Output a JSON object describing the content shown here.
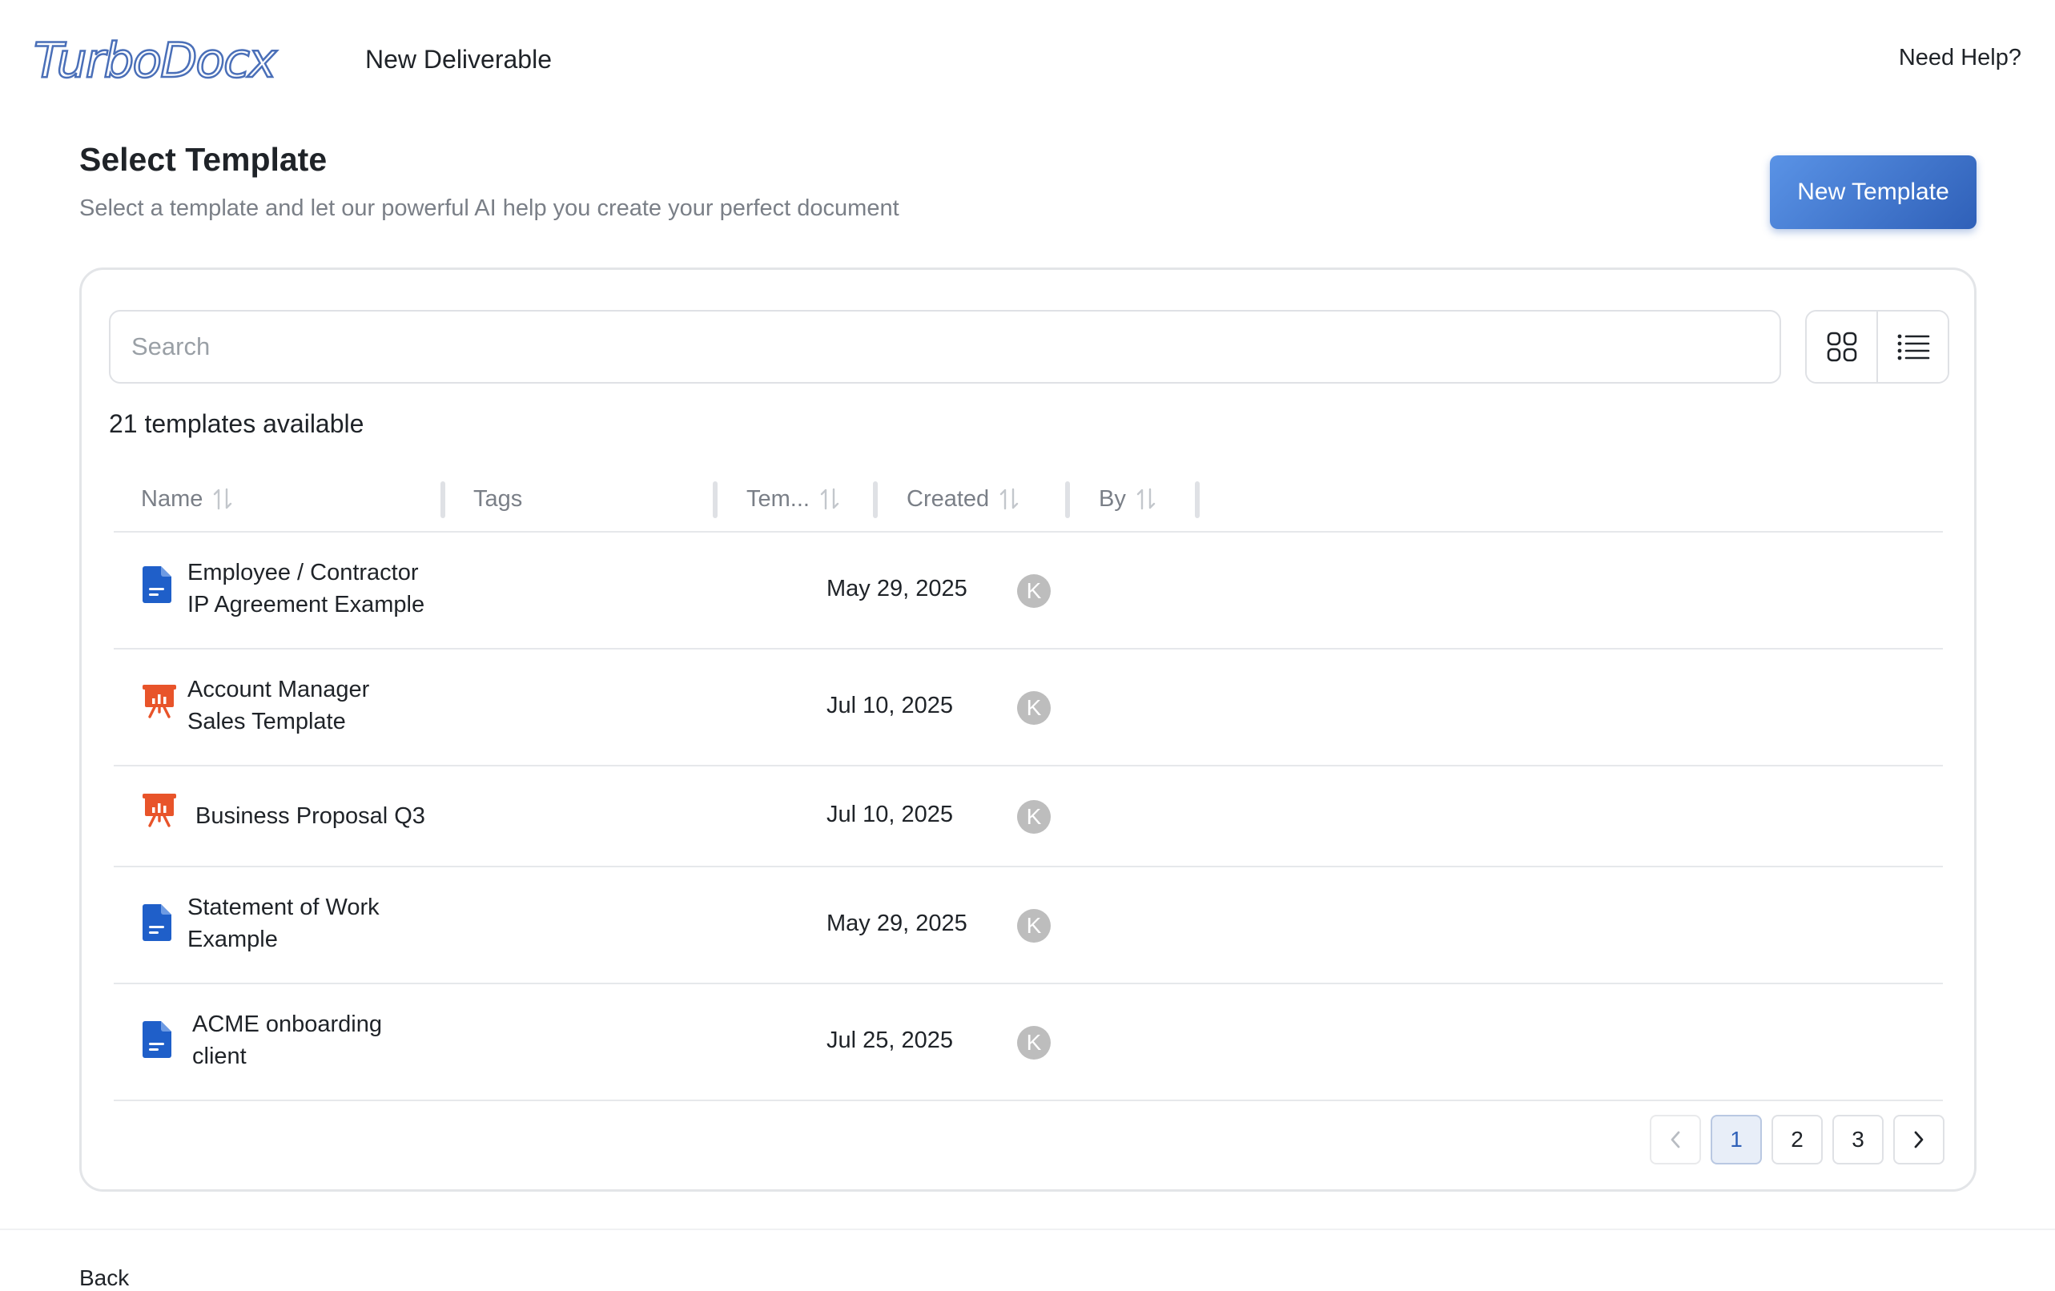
{
  "header": {
    "logo_text": "TurboDoc",
    "logo_suffix": "x",
    "title": "New Deliverable",
    "help_label": "Need Help?"
  },
  "page": {
    "title": "Select Template",
    "subtitle": "Select a template and let our powerful AI help you create your perfect document",
    "new_template_label": "New Template"
  },
  "search": {
    "placeholder": "Search",
    "value": ""
  },
  "view_toggle": {
    "grid_icon": "grid-icon",
    "list_icon": "list-icon",
    "active": "list"
  },
  "templates_count_label": "21 templates available",
  "table": {
    "columns": [
      {
        "label": "Name",
        "sortable": true
      },
      {
        "label": "Tags",
        "sortable": false
      },
      {
        "label": "Tem...",
        "sortable": true
      },
      {
        "label": "Created",
        "sortable": true
      },
      {
        "label": "By",
        "sortable": true
      }
    ],
    "rows": [
      {
        "type": "doc",
        "icon": "document-icon",
        "name_line1": "Employee / Contractor",
        "name_line2": "IP Agreement Example",
        "created": "May 29, 2025",
        "by": "K"
      },
      {
        "type": "ppt",
        "icon": "presentation-icon",
        "name_line1": "Account Manager",
        "name_line2": "Sales Template",
        "created": "Jul 10, 2025",
        "by": "K"
      },
      {
        "type": "ppt",
        "icon": "presentation-icon",
        "name_line1": "Business Proposal Q3",
        "name_line2": "",
        "created": "Jul 10, 2025",
        "by": "K"
      },
      {
        "type": "doc",
        "icon": "document-icon",
        "name_line1": "Statement of Work",
        "name_line2": "Example",
        "created": "May 29, 2025",
        "by": "K"
      },
      {
        "type": "doc",
        "icon": "document-icon",
        "name_line1": "ACME onboarding",
        "name_line2": "client",
        "created": "Jul 25, 2025",
        "by": "K"
      }
    ]
  },
  "pagination": {
    "pages": [
      "1",
      "2",
      "3"
    ],
    "current": "1",
    "prev_icon": "chevron-left-icon",
    "next_icon": "chevron-right-icon"
  },
  "footer": {
    "back_label": "Back"
  },
  "colors": {
    "accent": "#2f60b8",
    "doc_icon": "#1f5fc9",
    "ppt_icon": "#e8542a"
  }
}
